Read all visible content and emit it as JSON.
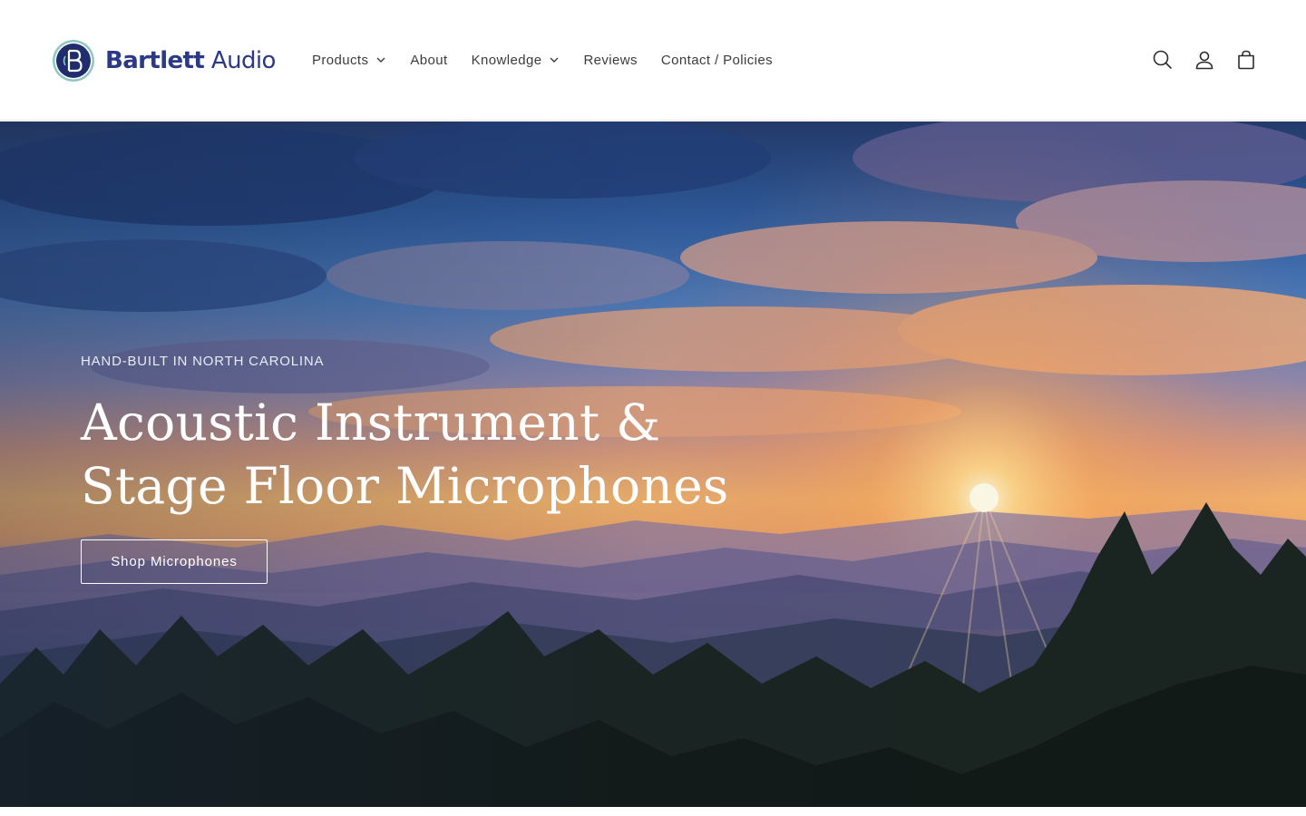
{
  "brand": {
    "name_bold": "Bartlett",
    "name_regular": " Audio",
    "logo_icon": "b-monogram-icon",
    "colors": {
      "primary": "#2c3a85",
      "accent_ring": "#8fc8c0"
    }
  },
  "nav": {
    "items": [
      {
        "label": "Products",
        "has_dropdown": true
      },
      {
        "label": "About",
        "has_dropdown": false
      },
      {
        "label": "Knowledge",
        "has_dropdown": true
      },
      {
        "label": "Reviews",
        "has_dropdown": false
      },
      {
        "label": "Contact / Policies",
        "has_dropdown": false
      }
    ]
  },
  "header_icons": [
    "search-icon",
    "account-icon",
    "cart-icon"
  ],
  "hero": {
    "eyebrow": "HAND-BUILT IN NORTH CAROLINA",
    "headline_line1": "Acoustic Instrument &",
    "headline_line2": "Stage Floor Microphones",
    "cta_label": "Shop Microphones",
    "image": "mountain-sunset-photo"
  }
}
